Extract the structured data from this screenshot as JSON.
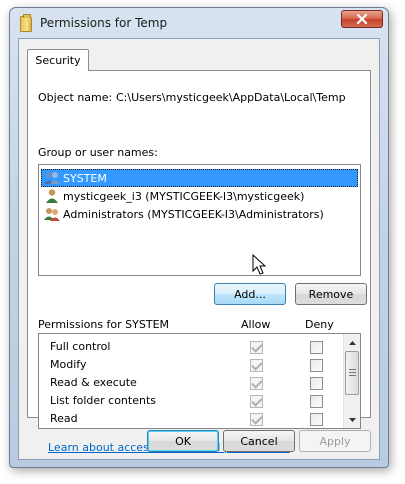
{
  "window": {
    "title": "Permissions for Temp",
    "icon": "folder-icon",
    "close_icon": "close-icon",
    "close_color": "#c4412a"
  },
  "tabs": [
    {
      "label": "Security",
      "active": true
    }
  ],
  "object": {
    "label": "Object name:",
    "value": "C:\\Users\\mysticgeek\\AppData\\Local\\Temp"
  },
  "groups": {
    "label": "Group or user names:",
    "items": [
      {
        "name": "SYSTEM",
        "icon": "users-group-icon",
        "selected": true
      },
      {
        "name": "mysticgeek_i3 (MYSTICGEEK-I3\\mysticgeek)",
        "icon": "user-icon",
        "selected": false
      },
      {
        "name": "Administrators (MYSTICGEEK-I3\\Administrators)",
        "icon": "users-group-icon",
        "selected": false
      }
    ],
    "add_label": "Add...",
    "remove_label": "Remove"
  },
  "permissions": {
    "header": "Permissions for SYSTEM",
    "allow_header": "Allow",
    "deny_header": "Deny",
    "rows": [
      {
        "name": "Full control",
        "allow": true,
        "deny": false
      },
      {
        "name": "Modify",
        "allow": true,
        "deny": false
      },
      {
        "name": "Read & execute",
        "allow": true,
        "deny": false
      },
      {
        "name": "List folder contents",
        "allow": true,
        "deny": false
      },
      {
        "name": "Read",
        "allow": true,
        "deny": false
      }
    ]
  },
  "link_text": "Learn about access control and permissions",
  "buttons": {
    "ok": "OK",
    "cancel": "Cancel",
    "apply": "Apply"
  },
  "colors": {
    "selection": "#3399ff",
    "link": "#0066cc"
  }
}
